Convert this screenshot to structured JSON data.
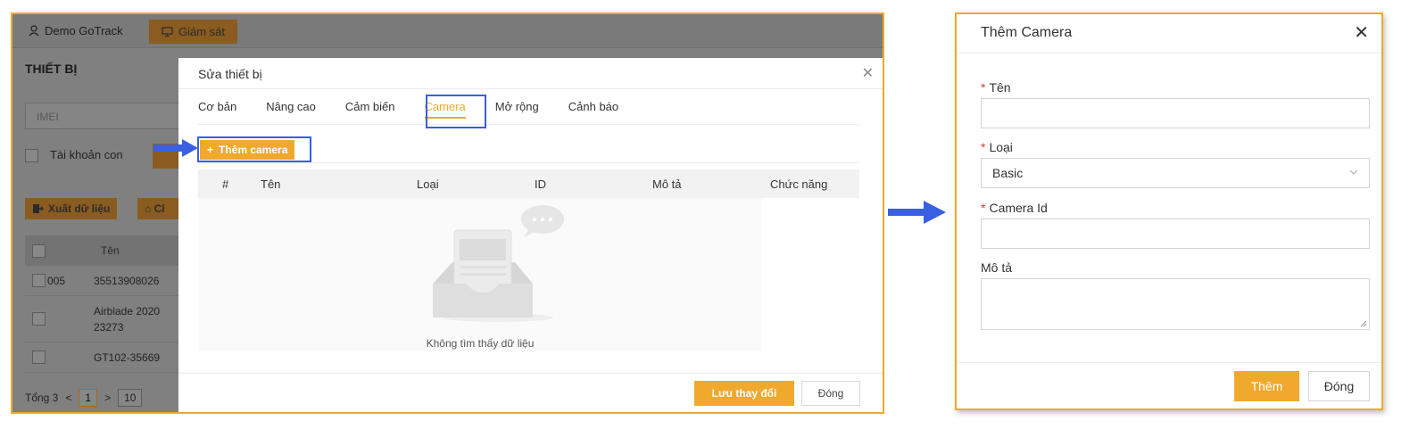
{
  "topbar": {
    "user": "Demo GoTrack",
    "monitor": "Giám sát"
  },
  "background": {
    "title": "THIẾT BỊ",
    "imei_placeholder": "IMEI",
    "sub_account": "Tài khoản con",
    "export": "Xuất dữ liệu",
    "export2": "Cl",
    "table_header_name": "Tên",
    "rows": [
      {
        "id": "005",
        "name": "35513908026"
      },
      {
        "id": "",
        "name": "Airblade 2020\n23273"
      },
      {
        "id": "",
        "name": "GT102-35669"
      }
    ],
    "pagination": {
      "total": "Tổng 3",
      "prev": "<",
      "page": "1",
      "next": ">",
      "size": "10"
    }
  },
  "modal": {
    "title": "Sửa thiết bị",
    "tabs": [
      "Cơ bản",
      "Nâng cao",
      "Cảm biến",
      "Camera",
      "Mở rộng",
      "Cảnh báo"
    ],
    "active_tab": "Camera",
    "add_button": "Thêm camera",
    "columns": [
      "#",
      "Tên",
      "Loại",
      "ID",
      "Mô tả",
      "Chức năng"
    ],
    "empty_text": "Không tìm thấy dữ liệu",
    "save_button": "Lưu thay đổi",
    "close_button": "Đóng"
  },
  "dialog": {
    "title": "Thêm Camera",
    "fields": {
      "name_label": "Tên",
      "type_label": "Loại",
      "type_value": "Basic",
      "camera_id_label": "Camera Id",
      "description_label": "Mô tả"
    },
    "add_button": "Thêm",
    "close_button": "Đóng"
  },
  "colors": {
    "accent": "#f0a92c",
    "highlight": "#3a5fe0",
    "required": "#e23a3a"
  }
}
